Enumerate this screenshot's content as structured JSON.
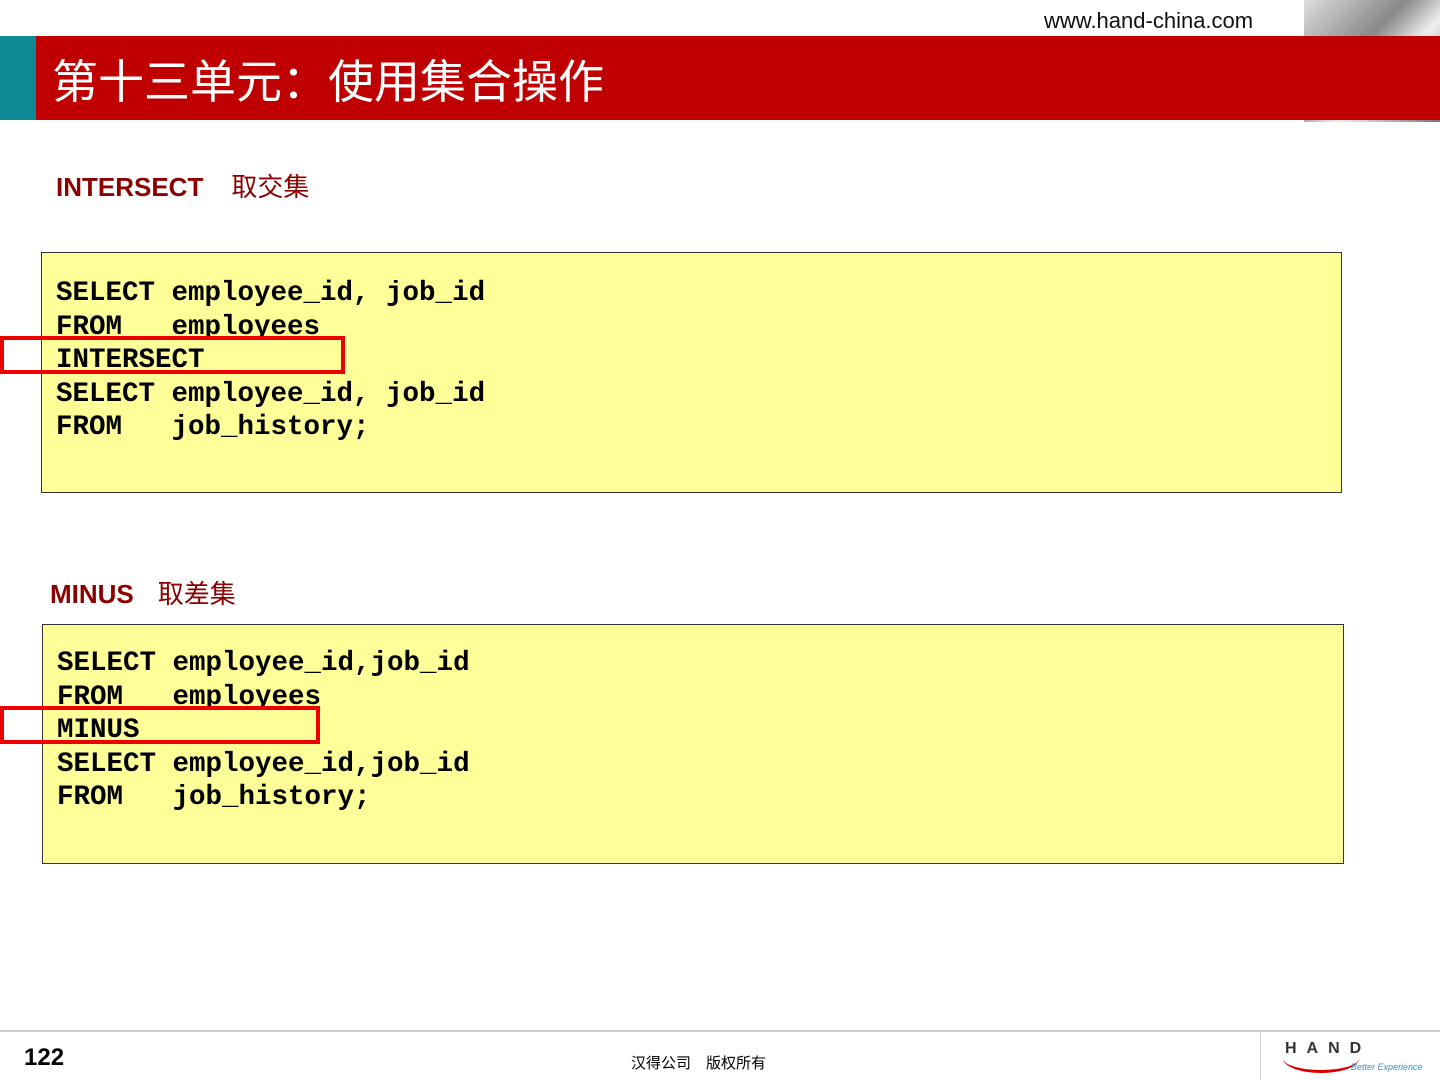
{
  "header": {
    "url": "www.hand-china.com",
    "title": "第十三单元：使用集合操作"
  },
  "sections": [
    {
      "keyword": "INTERSECT",
      "desc": "取交集",
      "code": "SELECT employee_id, job_id\nFROM   employees\nINTERSECT\nSELECT employee_id, job_id\nFROM   job_history;"
    },
    {
      "keyword": "MINUS",
      "desc": "取差集",
      "code": "SELECT employee_id,job_id\nFROM   employees\nMINUS\nSELECT employee_id,job_id\nFROM   job_history;"
    }
  ],
  "footer": {
    "page": "122",
    "copyright": "汉得公司　版权所有",
    "logo_text": "HAND",
    "logo_tagline": "Better Experience"
  },
  "colors": {
    "banner": "#c00000",
    "teal": "#0e8a96",
    "code_bg": "#ffff99",
    "highlight": "#e00000"
  }
}
